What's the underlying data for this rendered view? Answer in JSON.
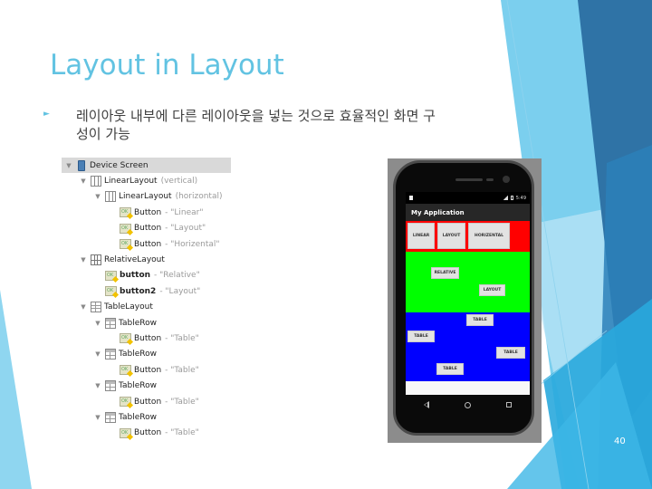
{
  "slide": {
    "title": "Layout in Layout",
    "bullet_text": "레이아웃 내부에 다른 레이아웃을 넣는 것으로 효율적인 화면 구성이 가능",
    "page_number": "40",
    "accent_color": "#62c3e2"
  },
  "component_tree": {
    "items": [
      {
        "label": "Device Screen",
        "sub": "",
        "icon": "device-icon"
      },
      {
        "label": "LinearLayout",
        "sub": "(vertical)",
        "icon": "linear-layout-icon"
      },
      {
        "label": "LinearLayout",
        "sub": "(horizontal)",
        "icon": "linear-layout-icon"
      },
      {
        "label": "Button",
        "sub": "- \"Linear\"",
        "icon": "button-widget-icon"
      },
      {
        "label": "Button",
        "sub": "- \"Layout\"",
        "icon": "button-widget-icon"
      },
      {
        "label": "Button",
        "sub": "- \"Horizental\"",
        "icon": "button-widget-icon"
      },
      {
        "label": "RelativeLayout",
        "sub": "",
        "icon": "relative-layout-icon"
      },
      {
        "label": "button",
        "sub": "- \"Relative\"",
        "icon": "button-widget-icon"
      },
      {
        "label": "button2",
        "sub": "- \"Layout\"",
        "icon": "button-widget-icon"
      },
      {
        "label": "TableLayout",
        "sub": "",
        "icon": "table-layout-icon"
      },
      {
        "label": "TableRow",
        "sub": "",
        "icon": "table-row-icon"
      },
      {
        "label": "Button",
        "sub": "- \"Table\"",
        "icon": "button-widget-icon"
      },
      {
        "label": "TableRow",
        "sub": "",
        "icon": "table-row-icon"
      },
      {
        "label": "Button",
        "sub": "- \"Table\"",
        "icon": "button-widget-icon"
      },
      {
        "label": "TableRow",
        "sub": "",
        "icon": "table-row-icon"
      },
      {
        "label": "Button",
        "sub": "- \"Table\"",
        "icon": "button-widget-icon"
      },
      {
        "label": "TableRow",
        "sub": "",
        "icon": "table-row-icon"
      },
      {
        "label": "Button",
        "sub": "- \"Table\"",
        "icon": "button-widget-icon"
      }
    ]
  },
  "phone": {
    "status_time": "5:49",
    "app_title": "My Application",
    "linear_buttons": [
      "LINEAR",
      "LAYOUT",
      "HORIZENTAL"
    ],
    "relative_buttons": [
      "RELATIVE",
      "LAYOUT"
    ],
    "table_buttons": [
      "TABLE",
      "TABLE",
      "TABLE",
      "TABLE"
    ],
    "colors": {
      "linear_bg": "#ff0000",
      "relative_bg": "#00ff00",
      "table_bg": "#0000ff"
    }
  }
}
